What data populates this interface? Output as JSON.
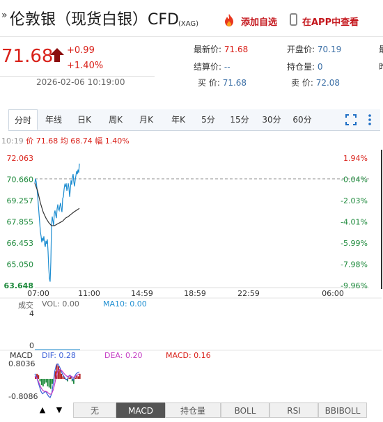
{
  "header": {
    "title_mark": "»",
    "title": "伦敦银（现货白银）CFD",
    "title_sub": "(XAG)",
    "add_watchlist": "添加自选",
    "view_in_app": "在APP中查看"
  },
  "quote": {
    "price": "71.68",
    "change": "+0.99",
    "change_pct": "+1.40%",
    "datetime": "2026-02-06 10:19:00"
  },
  "stats": {
    "latest_label": "最新价:",
    "latest_value": "71.68",
    "open_label": "开盘价:",
    "open_value": "70.19",
    "settle_label": "结算价:",
    "settle_value": "--",
    "oi_label": "持仓量:",
    "oi_value": "0",
    "bid_label": "买  价:",
    "bid_value": "71.68",
    "ask_label": "卖  价:",
    "ask_value": "72.08",
    "edge_top": "最",
    "edge_mid": "昨"
  },
  "tabs": [
    "分时",
    "年线",
    "日K",
    "周K",
    "月K",
    "年K",
    "5分",
    "15分",
    "30分",
    "60分"
  ],
  "active_tab": 0,
  "info_line": {
    "time": "10:19",
    "price": "价 71.68",
    "avg": "均 68.74",
    "amp": "幅 1.40%"
  },
  "chart_data": {
    "type": "line",
    "y_ticks_left": [
      "72.063",
      "70.660",
      "69.257",
      "67.855",
      "66.453",
      "65.050",
      "63.648"
    ],
    "y_ticks_right": [
      "1.94%",
      "-0.04%",
      "-2.03%",
      "-4.01%",
      "-5.99%",
      "-7.98%",
      "-9.96%"
    ],
    "x_ticks": [
      "07:00",
      "11:00",
      "14:59",
      "18:59",
      "22:59",
      "06:00"
    ],
    "ylim": [
      63.648,
      72.063
    ],
    "prev_close": 70.69,
    "series": [
      {
        "name": "价",
        "x": [
          0,
          1,
          2,
          3,
          4,
          5,
          6,
          7,
          8,
          9,
          10,
          11,
          12,
          13,
          14,
          15,
          16,
          17,
          18,
          19,
          20,
          21,
          22,
          23,
          24,
          25,
          26,
          27,
          28,
          29,
          30,
          31,
          32,
          33,
          34,
          35,
          36,
          37,
          38,
          39,
          40,
          41,
          42,
          43,
          44,
          45,
          46,
          47,
          48,
          49,
          50,
          51,
          52,
          53,
          54,
          55,
          56,
          57,
          58,
          59,
          60,
          61,
          62,
          63,
          64
        ],
        "values": [
          70.4,
          70.7,
          70.5,
          70.1,
          69.6,
          69.0,
          68.4,
          67.8,
          67.2,
          66.9,
          66.5,
          66.8,
          66.6,
          66.9,
          66.4,
          66.2,
          66.6,
          66.4,
          66.7,
          65.9,
          64.8,
          64.1,
          63.9,
          65.2,
          67.6,
          68.2,
          67.9,
          67.6,
          68.4,
          68.6,
          68.3,
          68.1,
          68.7,
          69.0,
          68.7,
          68.6,
          68.9,
          69.1,
          68.7,
          68.5,
          69.4,
          69.5,
          70.0,
          70.3,
          70.2,
          70.4,
          69.9,
          70.1,
          70.4,
          70.1,
          69.5,
          70.0,
          70.6,
          70.3,
          70.8,
          71.0,
          70.5,
          70.2,
          70.6,
          70.9,
          71.2,
          71.0,
          71.3,
          71.1,
          71.7
        ]
      },
      {
        "name": "均",
        "x": [
          0,
          4,
          8,
          12,
          16,
          20,
          24,
          28,
          32,
          36,
          40,
          44,
          48,
          52,
          56,
          60,
          64
        ],
        "values": [
          70.4,
          69.9,
          69.1,
          68.5,
          68.1,
          67.8,
          67.6,
          67.6,
          67.7,
          67.8,
          67.9,
          68.1,
          68.2,
          68.35,
          68.5,
          68.62,
          68.74
        ]
      }
    ],
    "x_total_minutes": 1380
  },
  "volume": {
    "label": "成交",
    "vol": "VOL: 0.00",
    "ma10": "MA10: 0.00",
    "y_top": "4",
    "y_bottom": "0"
  },
  "macd": {
    "label": "MACD",
    "dif": "DIF: 0.28",
    "dea": "DEA: 0.20",
    "macd": "MACD: 0.16",
    "y_top": "0.8036",
    "y_bottom": "-0.8086",
    "hist": [
      0.1,
      0.2,
      0.15,
      -0.1,
      -0.25,
      -0.3,
      -0.2,
      -0.15,
      -0.3,
      -0.35,
      -0.4,
      -0.2,
      -0.1,
      0.3,
      0.6,
      0.5,
      0.35,
      0.2,
      0.1,
      0.05,
      -0.05,
      -0.1,
      0.05,
      0.1,
      -0.1,
      -0.2,
      0.05,
      0.15,
      0.1,
      0.2
    ],
    "dif_line": [
      0.2,
      0.1,
      -0.1,
      -0.3,
      -0.5,
      -0.6,
      -0.55,
      -0.5,
      -0.6,
      -0.7,
      -0.75,
      -0.6,
      -0.2,
      0.3,
      0.55,
      0.6,
      0.5,
      0.35,
      0.2,
      0.1,
      0.0,
      -0.05,
      0.1,
      0.15,
      0.05,
      -0.05,
      0.1,
      0.2,
      0.25,
      0.28
    ],
    "dea_line": [
      0.1,
      0.05,
      -0.05,
      -0.2,
      -0.35,
      -0.45,
      -0.5,
      -0.5,
      -0.52,
      -0.58,
      -0.62,
      -0.6,
      -0.45,
      -0.2,
      0.1,
      0.3,
      0.38,
      0.36,
      0.3,
      0.22,
      0.15,
      0.1,
      0.1,
      0.12,
      0.1,
      0.06,
      0.08,
      0.12,
      0.16,
      0.2
    ]
  },
  "bottom_buttons": [
    "无",
    "MACD",
    "持仓量",
    "BOLL",
    "RSI",
    "BBIBOLL"
  ],
  "active_bottom": 1,
  "arrow_up": "▲",
  "arrow_down": "▼",
  "colors": {
    "up": "#d9211a",
    "down": "#1e8a3c",
    "price_line": "#1f8ed1",
    "avg_line": "#333333"
  }
}
